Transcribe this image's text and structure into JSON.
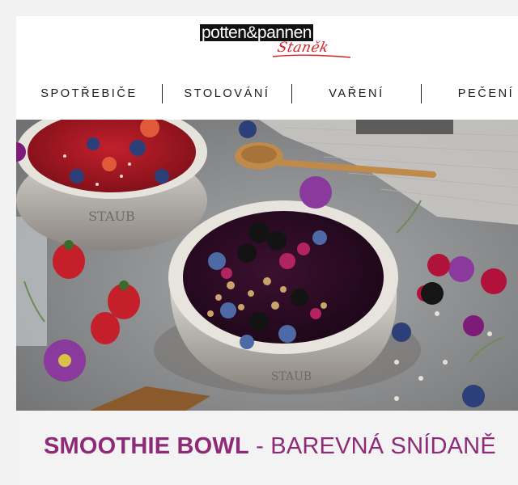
{
  "logo": {
    "brand": "potten&pannen",
    "sub": "Staněk"
  },
  "nav": {
    "items": [
      {
        "label": "SPOTŘEBIČE"
      },
      {
        "label": "STOLOVÁNÍ"
      },
      {
        "label": "VAŘENÍ"
      },
      {
        "label": "PEČENÍ"
      }
    ]
  },
  "hero": {
    "bowl_brand": "STAUB"
  },
  "article": {
    "title_bold": "SMOOTHIE BOWL",
    "title_rest": " - BAREVNÁ SNÍDANĚ"
  },
  "colors": {
    "accent": "#8e2a78",
    "logo_red": "#d22027"
  }
}
